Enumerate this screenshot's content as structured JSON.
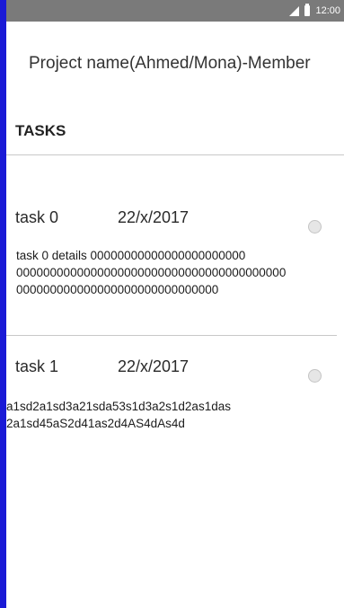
{
  "status_bar": {
    "time": "12:00",
    "icons": [
      "signal-icon",
      "battery-icon"
    ]
  },
  "project": {
    "title": "Project name(Ahmed/Mona)-Member"
  },
  "section": {
    "tasks_label": "TASKS"
  },
  "tasks": [
    {
      "name": "task 0",
      "date": "22/x/2017",
      "details_lines": [
        "task 0 details 00000000000000000000000",
        "0000000000000000000000000000000000000000",
        "000000000000000000000000000000"
      ]
    },
    {
      "name": "task 1",
      "date": "22/x/2017",
      "details_lines": [
        "a1sd2a1sd3a21sda53s1d3a2s1d2as1das",
        "2a1sd45aS2d41as2d4AS4dAs4d"
      ]
    }
  ]
}
